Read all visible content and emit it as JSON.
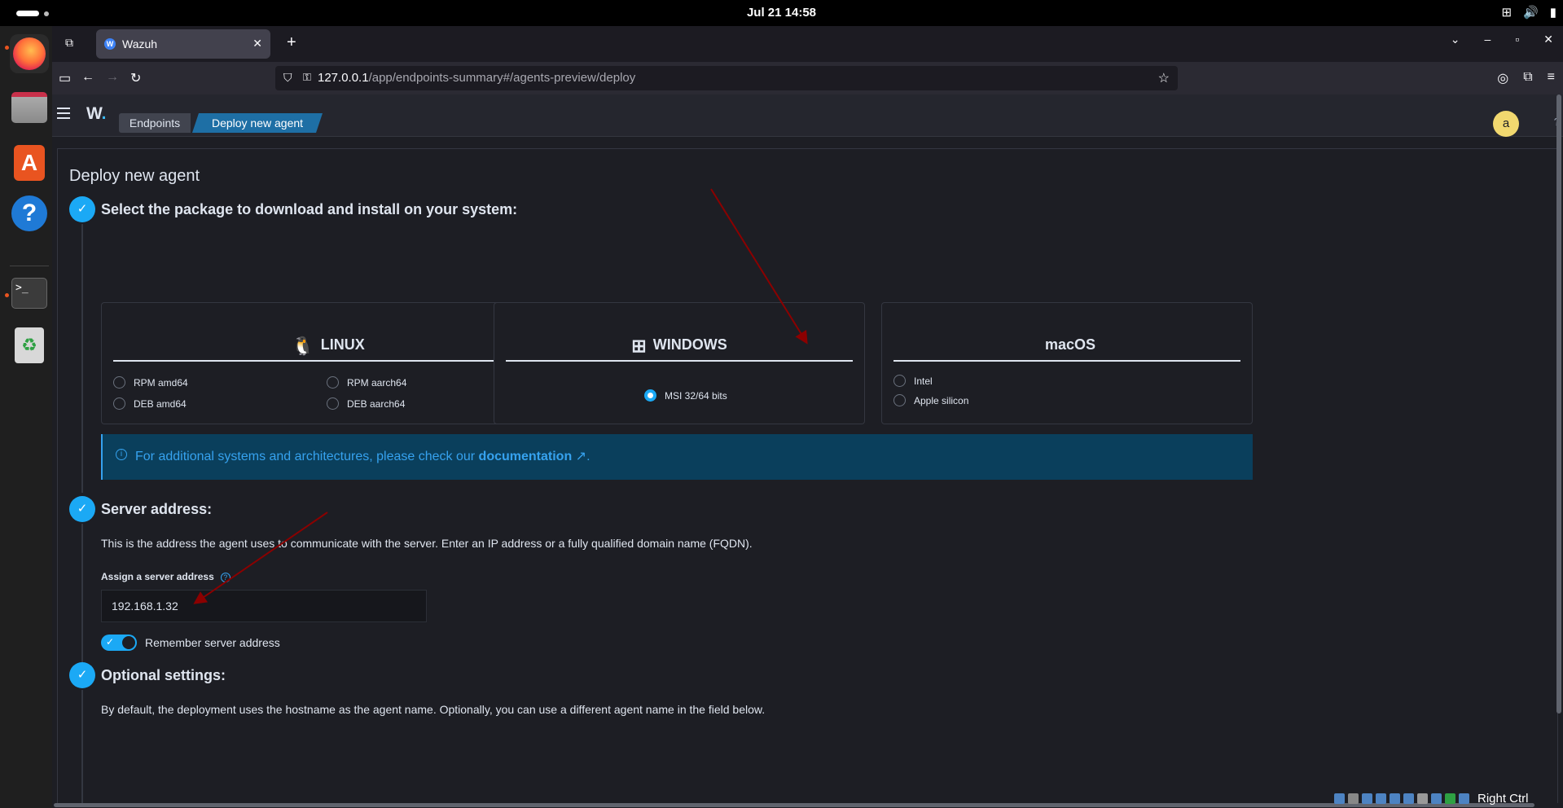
{
  "topbar": {
    "clock": "Jul 21  14:58"
  },
  "browser": {
    "tab": {
      "title": "Wazuh",
      "favicon_letter": "W"
    },
    "url_host": "127.0.0.1",
    "url_path": "/app/endpoints-summary#/agents-preview/deploy"
  },
  "app": {
    "logo": "W",
    "logo_dot": ".",
    "breadcrumbs": [
      "Endpoints",
      "Deploy new agent"
    ],
    "avatar_initial": "a"
  },
  "page": {
    "title": "Deploy new agent",
    "steps": [
      {
        "title": "Select the package to download and install on your system:"
      },
      {
        "title": "Server address:"
      },
      {
        "title": "Optional settings:"
      }
    ],
    "os_cards": {
      "linux": {
        "title": "LINUX",
        "options": [
          "RPM amd64",
          "RPM aarch64",
          "DEB amd64",
          "DEB aarch64"
        ]
      },
      "windows": {
        "title": "WINDOWS",
        "options": [
          "MSI 32/64 bits"
        ],
        "selected": "MSI 32/64 bits"
      },
      "macos": {
        "title": "macOS",
        "options": [
          "Intel",
          "Apple silicon"
        ]
      }
    },
    "callout": {
      "text": "For additional systems and architectures, please check our",
      "link": "documentation",
      "suffix": "."
    },
    "server": {
      "description": "This is the address the agent uses to communicate with the server. Enter an IP address or a fully qualified domain name (FQDN).",
      "label": "Assign a server address",
      "value": "192.168.1.32",
      "remember_label": "Remember server address",
      "remember_on": true
    },
    "optional": {
      "description": "By default, the deployment uses the hostname as the agent name. Optionally, you can use a different agent name in the field below."
    }
  },
  "statusbar": {
    "host_key": "Right Ctrl"
  },
  "colors": {
    "accent": "#1ba9f5",
    "background": "#1d1e24",
    "annotation_arrow": "#8b0000"
  }
}
